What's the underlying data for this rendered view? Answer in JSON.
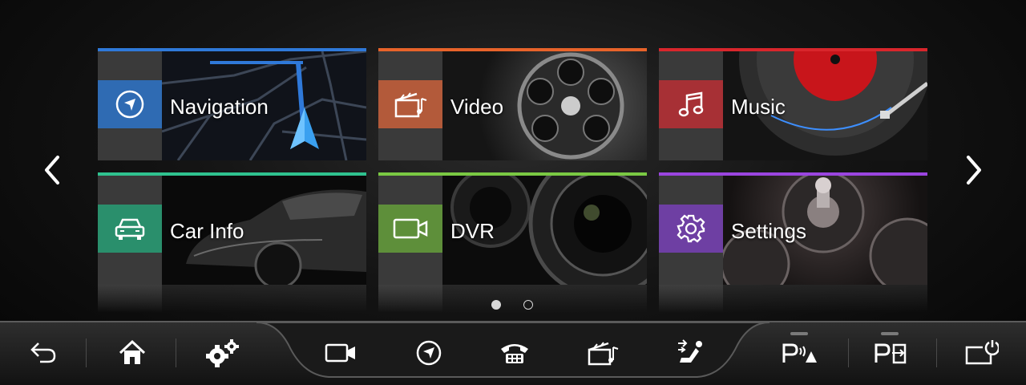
{
  "tiles": [
    {
      "label": "Navigation",
      "accent": "#2f79d9",
      "icon_bg": "#2f6bb3",
      "icon": "navigation-arrow-icon"
    },
    {
      "label": "Video",
      "accent": "#e8632a",
      "icon_bg": "#b35a3a",
      "icon": "clapperboard-icon"
    },
    {
      "label": "Music",
      "accent": "#d9262c",
      "icon_bg": "#a73035",
      "icon": "music-note-icon"
    },
    {
      "label": "Car Info",
      "accent": "#2fc28f",
      "icon_bg": "#2a8f6c",
      "icon": "car-icon"
    },
    {
      "label": "DVR",
      "accent": "#7ac943",
      "icon_bg": "#5e8f3a",
      "icon": "camera-icon"
    },
    {
      "label": "Settings",
      "accent": "#9b45e0",
      "icon_bg": "#6e3fa3",
      "icon": "gear-icon"
    }
  ],
  "pager": {
    "current": 1,
    "total": 2
  },
  "dock": {
    "items": [
      {
        "icon": "back-icon"
      },
      {
        "icon": "home-icon"
      },
      {
        "icon": "gears-icon"
      },
      {
        "icon": "video-camera-icon"
      },
      {
        "icon": "navigation-icon"
      },
      {
        "icon": "phone-icon"
      },
      {
        "icon": "clapperboard-icon"
      },
      {
        "icon": "seat-airflow-icon"
      },
      {
        "icon": "parking-sensor-icon"
      },
      {
        "icon": "auto-park-icon"
      },
      {
        "icon": "screen-power-icon"
      }
    ]
  },
  "colors": {
    "dock_bg": "#1e1e1e",
    "strip": "#3a3a3a"
  }
}
